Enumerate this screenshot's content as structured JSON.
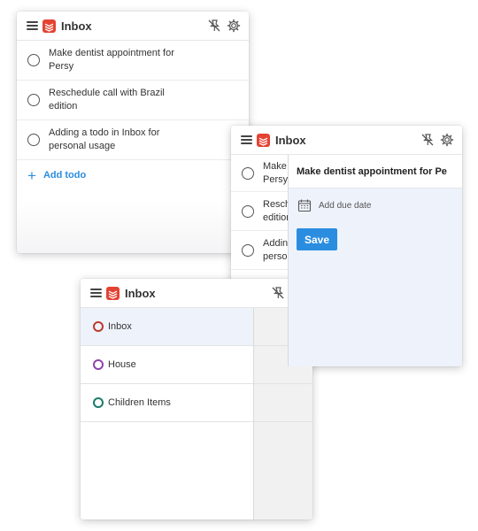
{
  "panel_main": {
    "title": "Inbox",
    "todos": [
      {
        "line1": "Make dentist appointment for",
        "line2": "Persy"
      },
      {
        "line1": "Reschedule call with Brazil",
        "line2": "edition"
      },
      {
        "line1": "Adding a todo in Inbox for",
        "line2": "personal usage"
      }
    ],
    "add_label": "Add todo"
  },
  "panel_detail": {
    "title": "Inbox",
    "todos_truncated": [
      {
        "line1": "Make d",
        "line2": "Persy"
      },
      {
        "line1": "Resche",
        "line2": "edition"
      },
      {
        "line1": "Adding",
        "line2": "person"
      }
    ],
    "detail_title": "Make dentist appointment for Pe",
    "due_label": "Add due date",
    "save_label": "Save"
  },
  "panel_projects": {
    "title": "Inbox",
    "projects": [
      {
        "label": "Inbox",
        "color": "#c0392b",
        "selected": true
      },
      {
        "label": "House",
        "color": "#8e44ad",
        "selected": false
      },
      {
        "label": "Children Items",
        "color": "#1a7a6a",
        "selected": false
      }
    ]
  },
  "colors": {
    "accent": "#2b8de0",
    "brand": "#e44232",
    "selected_bg": "#eef2fb"
  },
  "icons": [
    "menu-icon",
    "todoist-logo-icon",
    "unpin-icon",
    "gear-icon",
    "calendar-icon",
    "plus-icon"
  ]
}
